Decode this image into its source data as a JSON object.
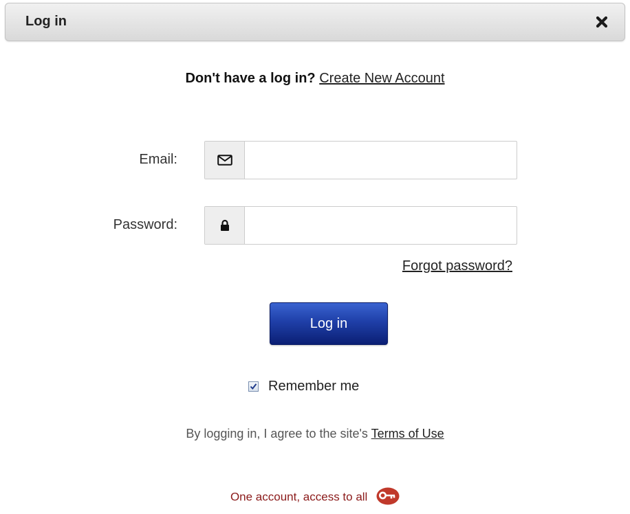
{
  "dialog": {
    "title": "Log in",
    "close_icon": "close-icon"
  },
  "signup": {
    "prompt": "Don't have a log in?",
    "link": "Create New Account"
  },
  "form": {
    "email_label": "Email:",
    "email_value": "",
    "email_icon": "envelope-icon",
    "password_label": "Password:",
    "password_value": "",
    "password_icon": "lock-icon",
    "forgot_link": "Forgot password?",
    "submit_label": "Log in",
    "remember_label": "Remember me",
    "remember_checked": true
  },
  "terms": {
    "prefix": "By logging in, I agree to the site's",
    "link": "Terms of Use"
  },
  "tagline": {
    "text": "One account, access to all",
    "icon": "key-icon"
  },
  "colors": {
    "button_blue": "#1f3fa8",
    "tagline_red": "#8b1a1a",
    "badge_red": "#c0392b"
  }
}
